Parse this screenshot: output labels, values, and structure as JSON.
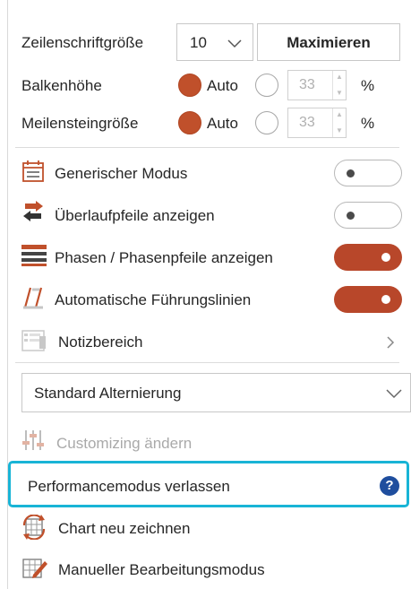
{
  "settings": {
    "row_font_size": {
      "label": "Zeilenschriftgröße",
      "value": "10",
      "maximize_label": "Maximieren"
    },
    "bar_height": {
      "label": "Balkenhöhe",
      "auto_label": "Auto",
      "value": "33",
      "unit": "%",
      "auto_selected": true
    },
    "milestone_size": {
      "label": "Meilensteingröße",
      "auto_label": "Auto",
      "value": "33",
      "unit": "%",
      "auto_selected": true
    }
  },
  "toggles": [
    {
      "label": "Generischer Modus",
      "on": false,
      "icon": "generic-mode-icon"
    },
    {
      "label": "Überlaufpfeile anzeigen",
      "on": false,
      "icon": "overflow-arrows-icon"
    },
    {
      "label": "Phasen / Phasenpfeile anzeigen",
      "on": true,
      "icon": "phases-icon"
    },
    {
      "label": "Automatische Führungslinien",
      "on": true,
      "icon": "guide-lines-icon"
    }
  ],
  "notes_area": {
    "label": "Notizbereich",
    "icon": "notes-area-icon"
  },
  "alternation_select": {
    "value": "Standard Alternierung"
  },
  "customizing": {
    "label": "Customizing ändern",
    "disabled": true,
    "icon": "customizing-icon"
  },
  "performance_mode": {
    "label": "Performancemodus verlassen",
    "help": "?"
  },
  "redraw_chart": {
    "label": "Chart neu zeichnen",
    "icon": "redraw-chart-icon"
  },
  "manual_edit": {
    "label": "Manueller Bearbeitungsmodus",
    "icon": "manual-edit-icon"
  },
  "colors": {
    "accent": "#c0502b",
    "toggle_on": "#b8472a",
    "highlight": "#18b4d6",
    "help_bg": "#1f4e9e"
  }
}
